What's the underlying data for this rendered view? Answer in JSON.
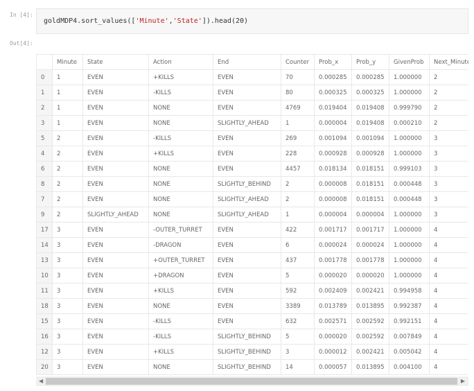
{
  "input_prompt": "In [4]:",
  "output_prompt": "Out[4]:",
  "code": {
    "prefix": "goldMDP4.sort_values([",
    "s1": "'Minute'",
    "comma": ",",
    "s2": "'State'",
    "suffix": "]).head(20)"
  },
  "table": {
    "columns": [
      "",
      "Minute",
      "State",
      "Action",
      "End",
      "Counter",
      "Prob_x",
      "Prob_y",
      "GivenProb",
      "Next_Minute"
    ],
    "rows": [
      [
        "0",
        "1",
        "EVEN",
        "+KILLS",
        "EVEN",
        "70",
        "0.000285",
        "0.000285",
        "1.000000",
        "2"
      ],
      [
        "1",
        "1",
        "EVEN",
        "-KILLS",
        "EVEN",
        "80",
        "0.000325",
        "0.000325",
        "1.000000",
        "2"
      ],
      [
        "2",
        "1",
        "EVEN",
        "NONE",
        "EVEN",
        "4769",
        "0.019404",
        "0.019408",
        "0.999790",
        "2"
      ],
      [
        "3",
        "1",
        "EVEN",
        "NONE",
        "SLIGHTLY_AHEAD",
        "1",
        "0.000004",
        "0.019408",
        "0.000210",
        "2"
      ],
      [
        "5",
        "2",
        "EVEN",
        "-KILLS",
        "EVEN",
        "269",
        "0.001094",
        "0.001094",
        "1.000000",
        "3"
      ],
      [
        "4",
        "2",
        "EVEN",
        "+KILLS",
        "EVEN",
        "228",
        "0.000928",
        "0.000928",
        "1.000000",
        "3"
      ],
      [
        "6",
        "2",
        "EVEN",
        "NONE",
        "EVEN",
        "4457",
        "0.018134",
        "0.018151",
        "0.999103",
        "3"
      ],
      [
        "8",
        "2",
        "EVEN",
        "NONE",
        "SLIGHTLY_BEHIND",
        "2",
        "0.000008",
        "0.018151",
        "0.000448",
        "3"
      ],
      [
        "7",
        "2",
        "EVEN",
        "NONE",
        "SLIGHTLY_AHEAD",
        "2",
        "0.000008",
        "0.018151",
        "0.000448",
        "3"
      ],
      [
        "9",
        "2",
        "SLIGHTLY_AHEAD",
        "NONE",
        "SLIGHTLY_AHEAD",
        "1",
        "0.000004",
        "0.000004",
        "1.000000",
        "3"
      ],
      [
        "17",
        "3",
        "EVEN",
        "-OUTER_TURRET",
        "EVEN",
        "422",
        "0.001717",
        "0.001717",
        "1.000000",
        "4"
      ],
      [
        "14",
        "3",
        "EVEN",
        "-DRAGON",
        "EVEN",
        "6",
        "0.000024",
        "0.000024",
        "1.000000",
        "4"
      ],
      [
        "13",
        "3",
        "EVEN",
        "+OUTER_TURRET",
        "EVEN",
        "437",
        "0.001778",
        "0.001778",
        "1.000000",
        "4"
      ],
      [
        "10",
        "3",
        "EVEN",
        "+DRAGON",
        "EVEN",
        "5",
        "0.000020",
        "0.000020",
        "1.000000",
        "4"
      ],
      [
        "11",
        "3",
        "EVEN",
        "+KILLS",
        "EVEN",
        "592",
        "0.002409",
        "0.002421",
        "0.994958",
        "4"
      ],
      [
        "18",
        "3",
        "EVEN",
        "NONE",
        "EVEN",
        "3389",
        "0.013789",
        "0.013895",
        "0.992387",
        "4"
      ],
      [
        "15",
        "3",
        "EVEN",
        "-KILLS",
        "EVEN",
        "632",
        "0.002571",
        "0.002592",
        "0.992151",
        "4"
      ],
      [
        "16",
        "3",
        "EVEN",
        "-KILLS",
        "SLIGHTLY_BEHIND",
        "5",
        "0.000020",
        "0.002592",
        "0.007849",
        "4"
      ],
      [
        "12",
        "3",
        "EVEN",
        "+KILLS",
        "SLIGHTLY_BEHIND",
        "3",
        "0.000012",
        "0.002421",
        "0.005042",
        "4"
      ],
      [
        "20",
        "3",
        "EVEN",
        "NONE",
        "SLIGHTLY_BEHIND",
        "14",
        "0.000057",
        "0.013895",
        "0.004100",
        "4"
      ]
    ]
  },
  "scroll": {
    "left_arrow": "◀",
    "right_arrow": "▶"
  }
}
